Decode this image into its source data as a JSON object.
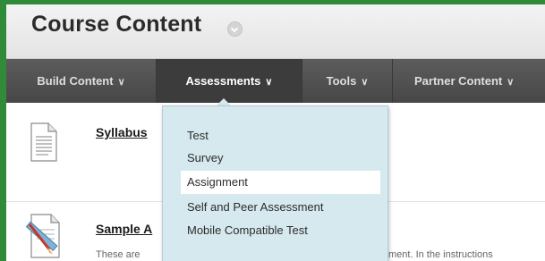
{
  "header": {
    "title": "Course Content"
  },
  "nav": {
    "tabs": [
      {
        "label": "Build Content",
        "chevron": "∨"
      },
      {
        "label": "Assessments",
        "chevron": "∨"
      },
      {
        "label": "Tools",
        "chevron": "∨"
      },
      {
        "label": "Partner Content",
        "chevron": "∨"
      }
    ]
  },
  "dropdown": {
    "items": [
      "Test",
      "Survey",
      "Assignment",
      "Self and Peer Assessment",
      "Mobile Compatible Test"
    ],
    "hovered_index": 2
  },
  "content": {
    "items": [
      {
        "title": "Syllabus",
        "icon": "document-icon"
      },
      {
        "title": "Sample A",
        "icon": "assignment-icon",
        "description": "These are",
        "description_continued": "ment. In the instructions"
      }
    ]
  },
  "colors": {
    "frame_border": "#2f8a3a",
    "navbar": "#4e4e4e",
    "active_tab": "#3c3c3c",
    "dropdown_bg": "#d5e9ee"
  }
}
